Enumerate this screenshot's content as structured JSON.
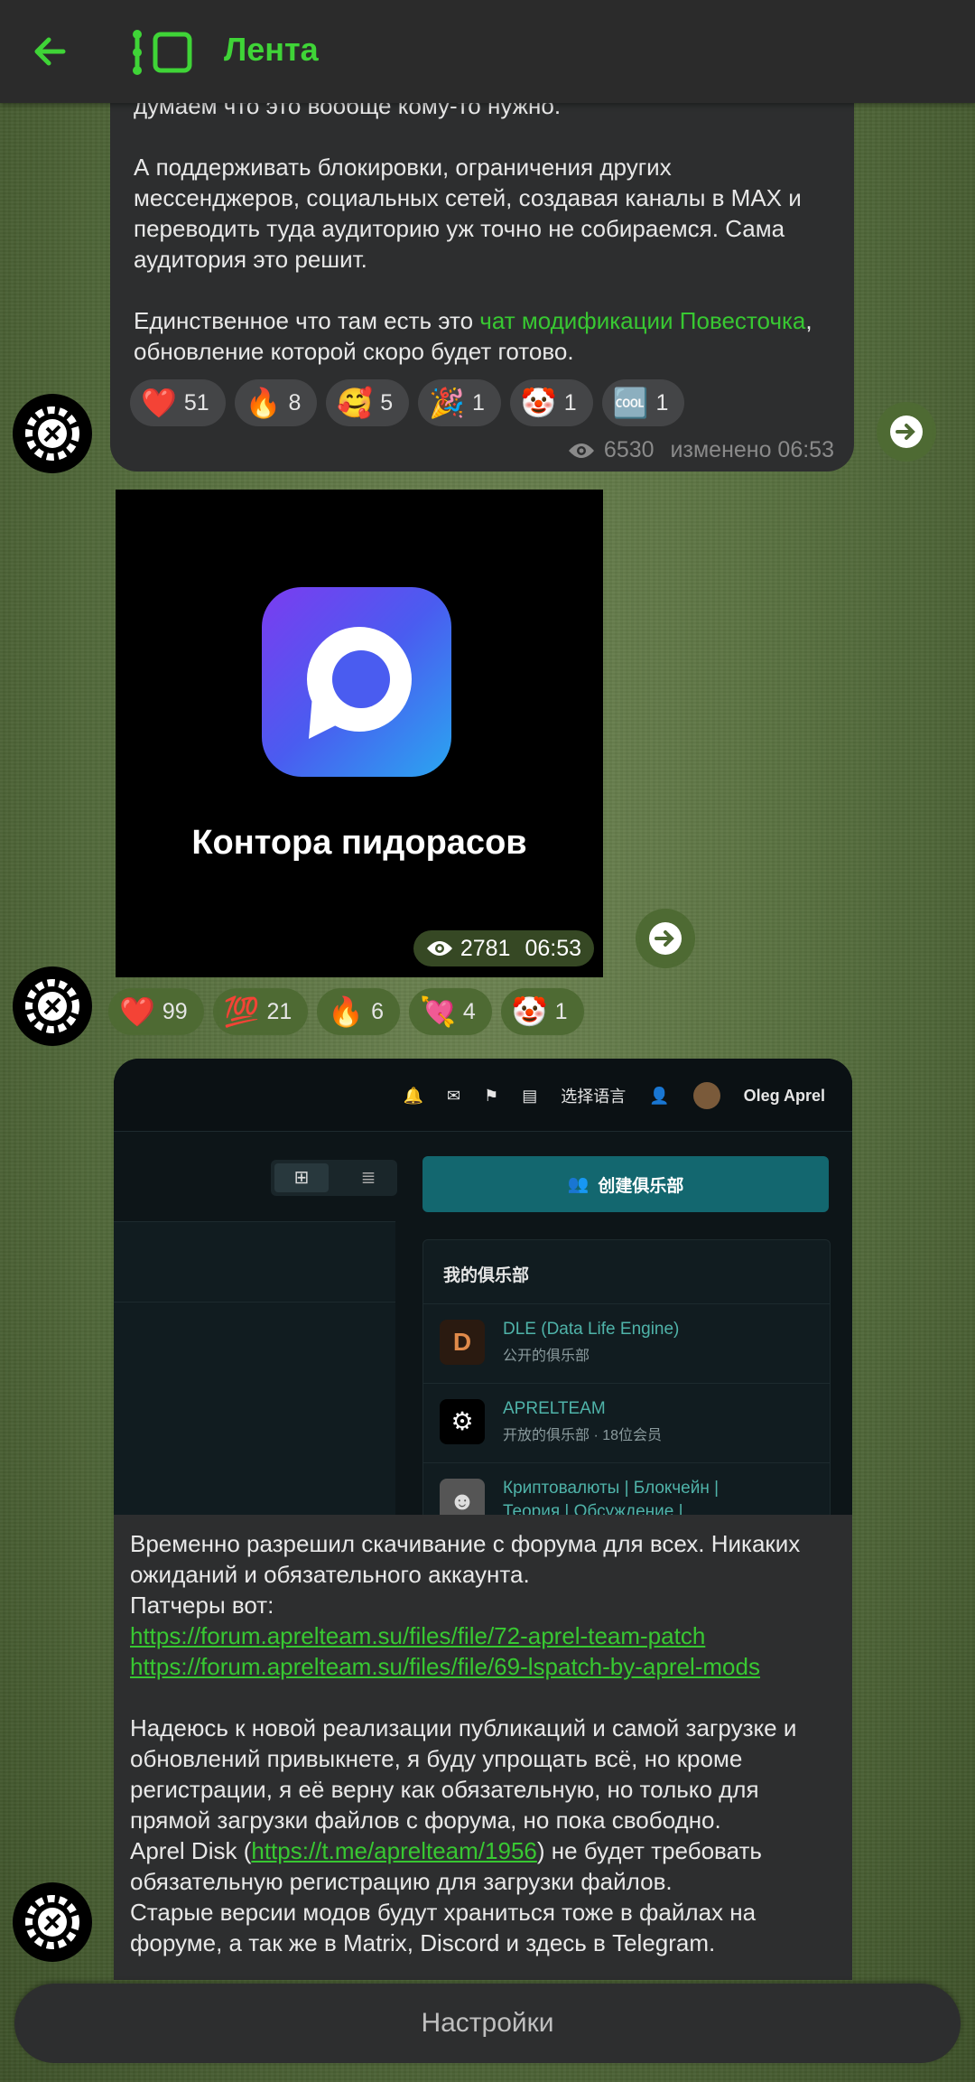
{
  "header": {
    "title": "Лента",
    "back_icon": "arrow-left-icon",
    "feed_icon": "feed-list-icon",
    "accent": "#3fd437"
  },
  "post1": {
    "paragraphs": [
      "думаем что это вообще кому-то нужно.",
      "А поддерживать блокировки, ограничения других мессенджеров, социальных сетей, создавая каналы в MAX и переводить туда аудиторию уж точно не собираемся. Сама аудитория это решит."
    ],
    "last_prefix": "Единственное что там есть это ",
    "last_link": "чат модификации Повесточка",
    "last_suffix": ", обновление которой скоро будет готово.",
    "reactions": [
      {
        "emoji": "❤️",
        "count": "51"
      },
      {
        "emoji": "🔥",
        "count": "8"
      },
      {
        "emoji": "🥰",
        "count": "5"
      },
      {
        "emoji": "🎉",
        "count": "1"
      },
      {
        "emoji": "🤡",
        "count": "1"
      },
      {
        "emoji": "🆒",
        "count": "1"
      }
    ],
    "views": "6530",
    "edited": "изменено 06:53"
  },
  "post2": {
    "caption": "Контора пидорасов",
    "views": "2781",
    "time": "06:53",
    "reactions": [
      {
        "emoji": "❤️",
        "count": "99"
      },
      {
        "emoji": "💯",
        "count": "21"
      },
      {
        "emoji": "🔥",
        "count": "6"
      },
      {
        "emoji": "💘",
        "count": "4"
      },
      {
        "emoji": "🤡",
        "count": "1"
      }
    ]
  },
  "post3": {
    "screenshot": {
      "lang": "选择语言",
      "user": "Oleg Aprel",
      "create_club": "创建俱乐部",
      "my_clubs": "我的俱乐部",
      "clubs": [
        {
          "name": "DLE (Data Life Engine)",
          "sub": "公开的俱乐部"
        },
        {
          "name": "APRELTEAM",
          "sub": "开放的俱乐部 · 18位会员"
        },
        {
          "name": "Криптовалюты | Блокчейн |",
          "sub": "Теория | Обсуждение |"
        }
      ]
    },
    "line1": "Временно разрешил скачивание с форума для всех. Никаких ожиданий и обязательного аккаунта.",
    "line2": "Патчеры вот:",
    "link1": "https://forum.aprelteam.su/files/file/72-aprel-team-patch",
    "link2": "https://forum.aprelteam.su/files/file/69-lspatch-by-aprel-mods",
    "para2": "Надеюсь к новой реализации публикаций и самой загрузке и обновлений привыкнете, я буду упрощать всё, но кроме регистрации, я её верну как обязательную, но только для прямой загрузки файлов с форума, но пока свободно.",
    "disk_prefix": "Aprel Disk (",
    "disk_link": "https://t.me/aprelteam/1956",
    "disk_suffix": ") не будет требовать обязательную регистрацию для загрузки файлов.",
    "para3": "Старые версии модов будут храниться тоже в файлах на форуме, а так же в Matrix, Discord и здесь в Telegram."
  },
  "footer": {
    "settings_label": "Настройки"
  }
}
